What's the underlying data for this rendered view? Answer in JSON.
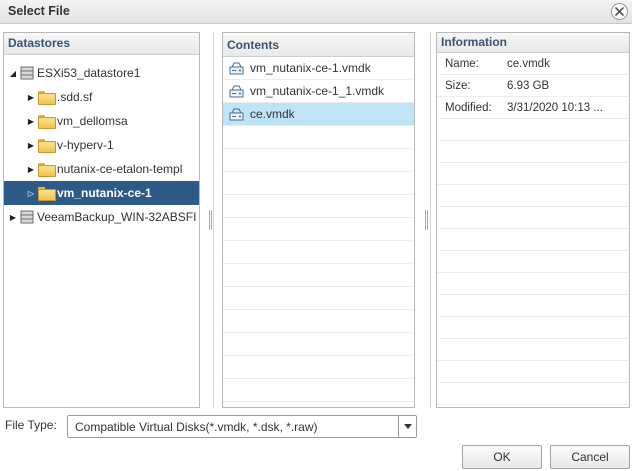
{
  "window": {
    "title": "Select File"
  },
  "datastores": {
    "header": "Datastores",
    "items": [
      {
        "label": "ESXi53_datastore1",
        "type": "datastore",
        "expanded": true,
        "level": 0,
        "selected": false
      },
      {
        "label": ".sdd.sf",
        "type": "folder",
        "expanded": false,
        "level": 1,
        "selected": false
      },
      {
        "label": "vm_dellomsa",
        "type": "folder",
        "expanded": false,
        "level": 1,
        "selected": false
      },
      {
        "label": "v-hyperv-1",
        "type": "folder",
        "expanded": false,
        "level": 1,
        "selected": false
      },
      {
        "label": "nutanix-ce-etalon-templ",
        "type": "folder",
        "expanded": false,
        "level": 1,
        "selected": false
      },
      {
        "label": "vm_nutanix-ce-1",
        "type": "folder",
        "expanded": false,
        "level": 1,
        "selected": true
      },
      {
        "label": "VeeamBackup_WIN-32ABSFI",
        "type": "datastore",
        "expanded": false,
        "level": 0,
        "selected": false
      }
    ]
  },
  "contents": {
    "header": "Contents",
    "items": [
      {
        "label": "vm_nutanix-ce-1.vmdk",
        "selected": false,
        "icon": "virtual-disk-icon"
      },
      {
        "label": "vm_nutanix-ce-1_1.vmdk",
        "selected": false,
        "icon": "virtual-disk-icon"
      },
      {
        "label": "ce.vmdk",
        "selected": true,
        "icon": "virtual-disk-icon"
      }
    ]
  },
  "information": {
    "header": "Information",
    "rows": [
      {
        "key": "Name:",
        "value": "ce.vmdk"
      },
      {
        "key": "Size:",
        "value": "6.93 GB"
      },
      {
        "key": "Modified:",
        "value": "3/31/2020 10:13 ..."
      }
    ]
  },
  "file_type": {
    "label": "File Type:",
    "value": "Compatible Virtual Disks(*.vmdk, *.dsk, *.raw)"
  },
  "buttons": {
    "ok": "OK",
    "cancel": "Cancel"
  },
  "colors": {
    "selection_dark": "#2d5a86",
    "selection_light": "#bfe3f7",
    "header_text": "#3c5470"
  }
}
